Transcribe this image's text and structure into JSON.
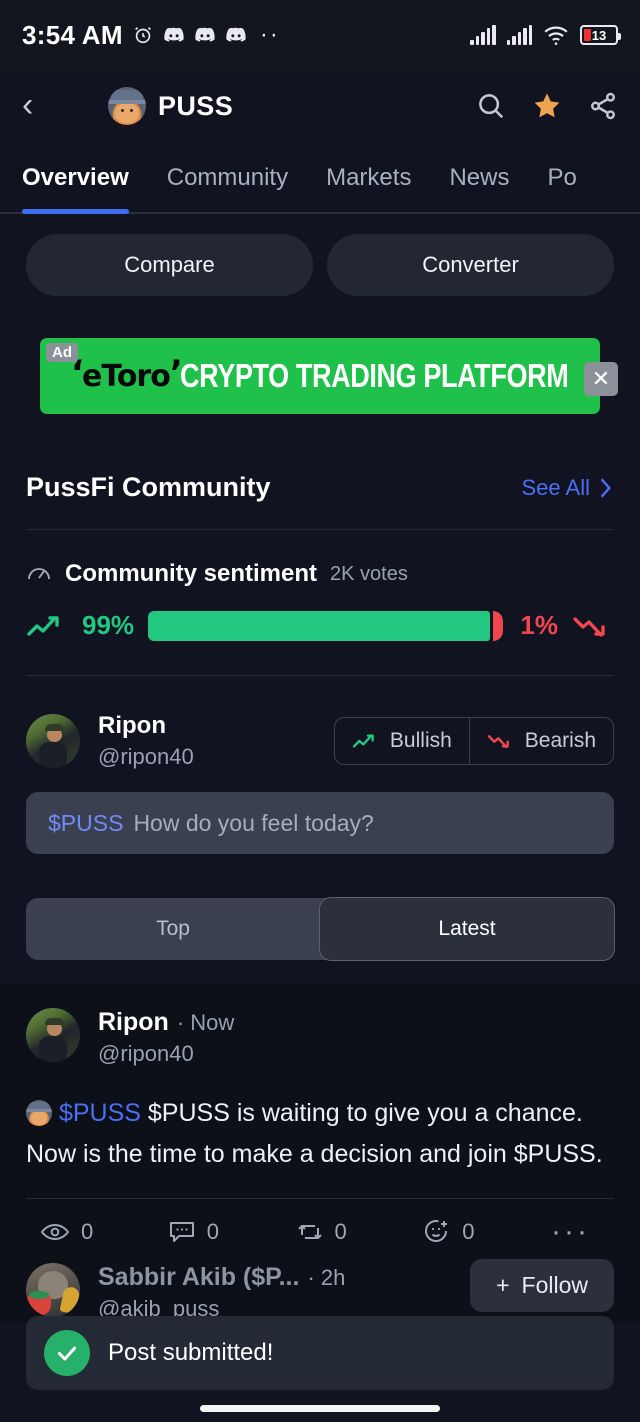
{
  "status_bar": {
    "time": "3:54 AM",
    "icons": [
      "alarm-clock-icon",
      "discord-icon",
      "discord-icon",
      "discord-icon",
      "more-notifications-dots"
    ],
    "battery_percent": "13",
    "right_icons": [
      "signal-bars-1",
      "signal-bars-2",
      "wifi-icon",
      "battery-icon"
    ]
  },
  "header": {
    "back_icon": "chevron-left-icon",
    "coin_avatar": "puss-cat-hat-avatar",
    "title": "PUSS",
    "search_icon": "search-icon",
    "favorite_icon": "star-icon-filled",
    "favorite_color": "#f0a452",
    "share_icon": "share-nodes-icon"
  },
  "tabs": {
    "items": [
      {
        "label": "Overview",
        "active": true
      },
      {
        "label": "Community",
        "active": false
      },
      {
        "label": "Markets",
        "active": false
      },
      {
        "label": "News",
        "active": false
      },
      {
        "label": "Po",
        "active": false
      }
    ],
    "active_underline_color": "#3d6df0"
  },
  "quick_actions": {
    "compare_label": "Compare",
    "converter_label": "Converter"
  },
  "ad": {
    "badge": "Ad",
    "brand": "eToro",
    "headline": "CRYPTO TRADING PLATFORM",
    "close_icon": "close-x-icon",
    "background_color": "#20c14a"
  },
  "community_section": {
    "title": "PussFi Community",
    "see_all_label": "See All",
    "see_all_icon": "chevron-right-icon",
    "see_all_color": "#4b6ef5"
  },
  "sentiment": {
    "gauge_icon": "gauge-icon",
    "title": "Community sentiment",
    "votes": "2K votes",
    "bullish_percent": "99%",
    "bearish_percent": "1%",
    "bullish_value": 99,
    "bearish_value": 1,
    "bullish_color": "#22c780",
    "bearish_color": "#f0464f",
    "up_icon": "trend-up-icon",
    "down_icon": "trend-down-icon"
  },
  "compose": {
    "user": {
      "name": "Ripon",
      "handle": "@ripon40",
      "avatar": "ripon-avatar"
    },
    "bullish_label": "Bullish",
    "bearish_label": "Bearish",
    "cashtag": "$PUSS",
    "placeholder": "How do you feel today?"
  },
  "feed_filter": {
    "options": [
      {
        "label": "Top",
        "active": false
      },
      {
        "label": "Latest",
        "active": true
      }
    ]
  },
  "feed": {
    "posts": [
      {
        "author": "Ripon",
        "handle": "@ripon40",
        "time": "Now",
        "emoji": "puss-cat-hat-emoji",
        "cashtag": "$PUSS",
        "body": "$PUSS  is waiting to give you a chance.  Now is the time to make a decision and join $PUSS.",
        "actions": [
          {
            "icon": "eye-icon",
            "count": "0"
          },
          {
            "icon": "comment-icon",
            "count": "0"
          },
          {
            "icon": "repost-icon",
            "count": "0"
          },
          {
            "icon": "add-reaction-icon",
            "count": "0"
          },
          {
            "icon": "more-horizontal-icon",
            "count": ""
          }
        ]
      },
      {
        "author": "Sabbir Akib ($P...",
        "handle": "@akib_puss",
        "time": "2h",
        "follow_label": "Follow",
        "follow_icon": "plus-icon"
      }
    ]
  },
  "toast": {
    "icon": "check-circle-icon",
    "message": "Post submitted!",
    "icon_color": "#27b06a"
  },
  "home_indicator": "home-gesture-bar"
}
